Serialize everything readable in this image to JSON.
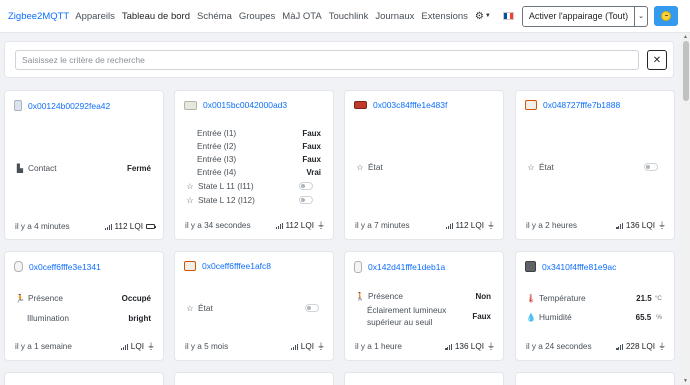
{
  "nav": {
    "brand": "Zigbee2MQTT",
    "links": [
      "Appareils",
      "Tableau de bord",
      "Schéma",
      "Groupes",
      "MàJ OTA",
      "Touchlink",
      "Journaux",
      "Extensions"
    ],
    "permit_join": "Activer l'appairage (Tout)"
  },
  "search": {
    "placeholder": "Saisissez le critère de recherche",
    "clear_icon": "close-icon"
  },
  "devices": [
    {
      "id": "0x00124b00292fea42",
      "rows": [
        {
          "label": "Contact",
          "value": "Fermé"
        }
      ],
      "last_seen": "il y a 4 minutes",
      "lqi": "112 LQI",
      "power": "battery"
    },
    {
      "id": "0x0015bc0042000ad3",
      "rows": [
        {
          "label": "Entrée (I1)",
          "value": "Faux"
        },
        {
          "label": "Entrée (I2)",
          "value": "Faux"
        },
        {
          "label": "Entrée (I3)",
          "value": "Faux"
        },
        {
          "label": "Entrée (I4)",
          "value": "Vrai"
        },
        {
          "label": "State L 11 (I11)",
          "value": ""
        },
        {
          "label": "State L 12 (I12)",
          "value": ""
        }
      ],
      "last_seen": "il y a 34 secondes",
      "lqi": "112 LQI",
      "power": "mains"
    },
    {
      "id": "0x003c84fffe1e483f",
      "rows": [
        {
          "label": "État",
          "value": ""
        }
      ],
      "last_seen": "il y a 7 minutes",
      "lqi": "112 LQI",
      "power": "mains"
    },
    {
      "id": "0x048727fffe7b1888",
      "rows": [
        {
          "label": "État",
          "value": ""
        }
      ],
      "last_seen": "il y a 2 heures",
      "lqi": "136 LQI",
      "power": "mains"
    },
    {
      "id": "0x0ceff6fffe3e1341",
      "rows": [
        {
          "label": "Présence",
          "value": "Occupé"
        },
        {
          "label": "Illumination",
          "value": "bright"
        }
      ],
      "last_seen": "il y a 1 semaine",
      "lqi": "LQI",
      "power": "mains"
    },
    {
      "id": "0x0ceff6fffee1afc8",
      "rows": [
        {
          "label": "État",
          "value": ""
        }
      ],
      "last_seen": "il y a 5 mois",
      "lqi": "LQI",
      "power": "mains"
    },
    {
      "id": "0x142d41fffe1deb1a",
      "rows": [
        {
          "label": "Présence",
          "value": "Non"
        },
        {
          "label": "Éclairement lumineux supérieur au seuil",
          "value": "Faux"
        }
      ],
      "last_seen": "il y a 1 heure",
      "lqi": "136 LQI",
      "power": "mains"
    },
    {
      "id": "0x3410f4fffe81e9ac",
      "rows": [
        {
          "label": "Température",
          "value": "21.5",
          "unit": "°C"
        },
        {
          "label": "Humidité",
          "value": "65.5",
          "unit": "%"
        }
      ],
      "last_seen": "il y a 24 secondes",
      "lqi": "228 LQI",
      "power": "mains"
    }
  ]
}
